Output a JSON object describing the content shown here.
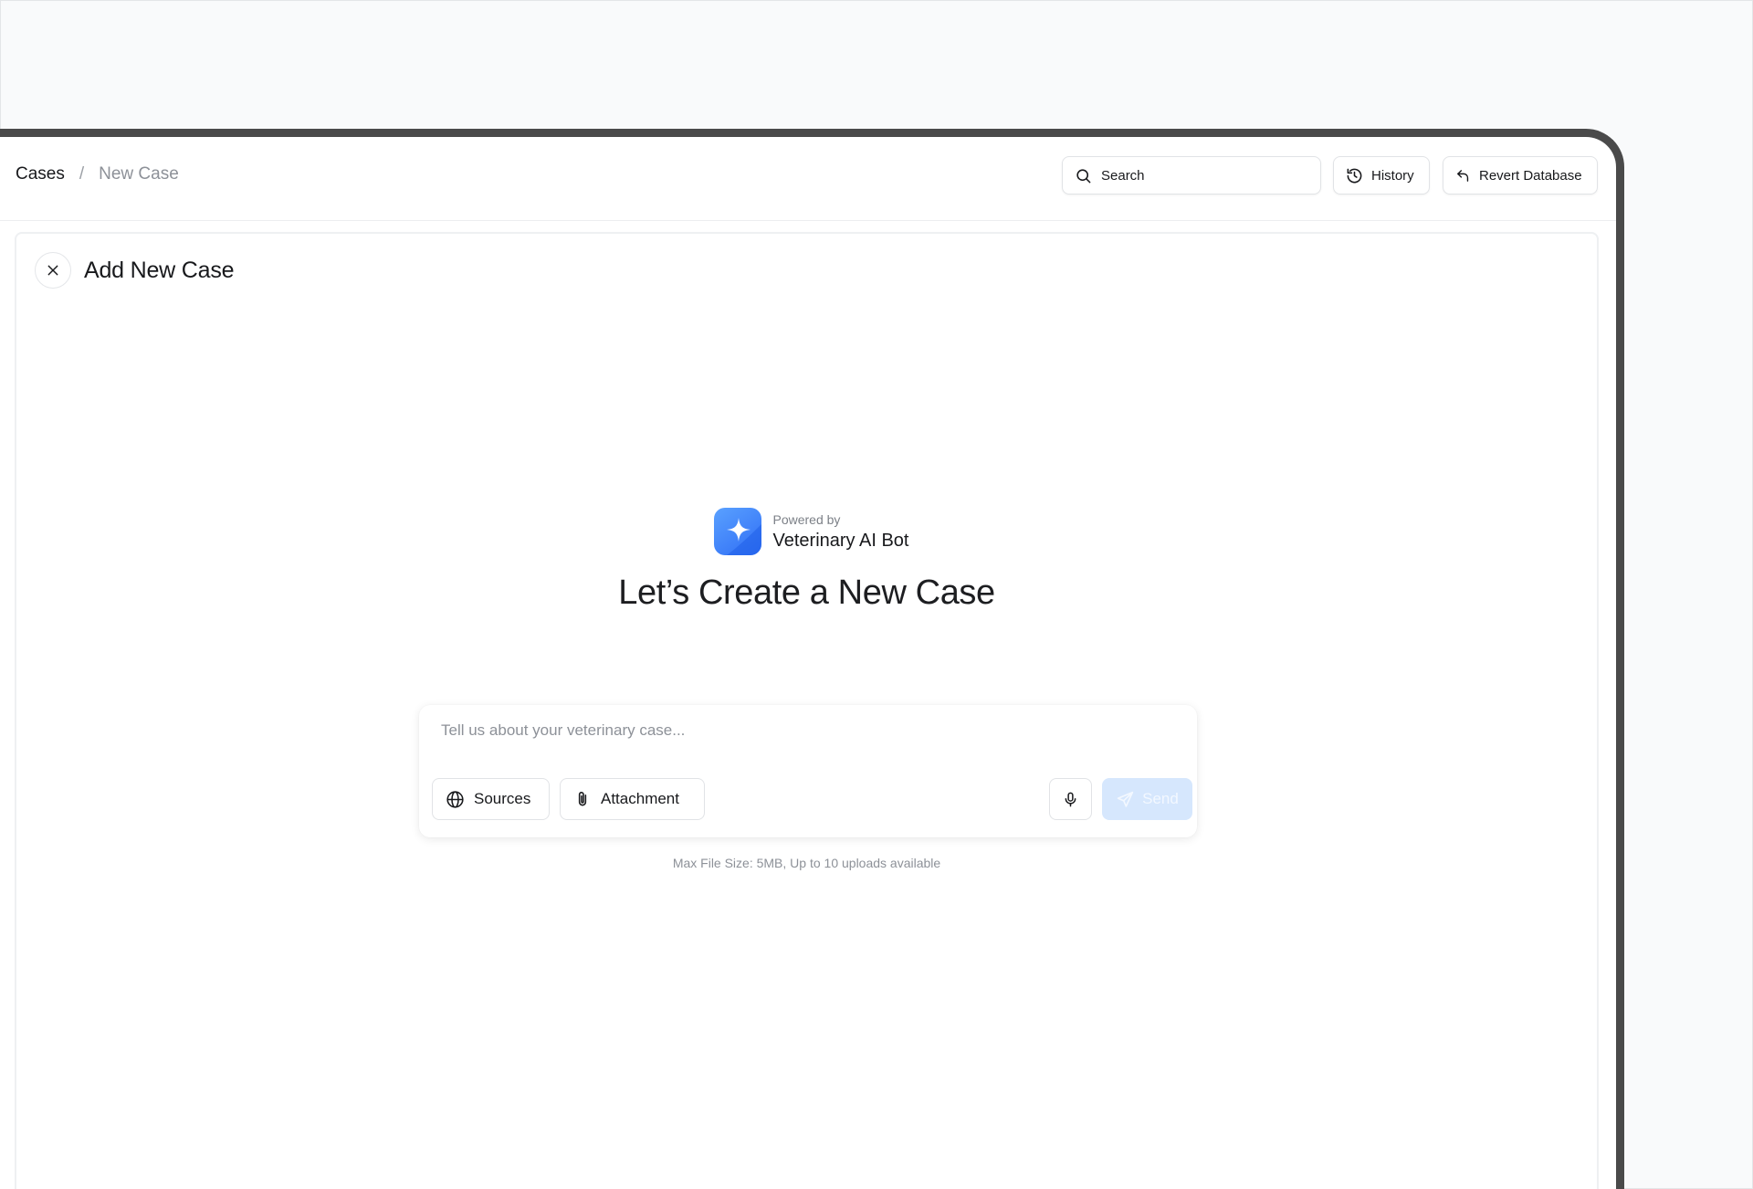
{
  "breadcrumb": {
    "root": "Cases",
    "separator": "/",
    "current": "New Case"
  },
  "header": {
    "search_placeholder": "Search",
    "history_label": "History",
    "revert_label": "Revert Database"
  },
  "panel": {
    "title": "Add New Case"
  },
  "hero": {
    "powered_by": "Powered by",
    "bot_name": "Veterinary AI Bot",
    "title": "Let’s Create a New Case"
  },
  "composer": {
    "placeholder": "Tell us about your veterinary case...",
    "value": "",
    "sources_label": "Sources",
    "attachment_label": "Attachment",
    "send_label": "Send",
    "hint": "Max File Size: 5MB, Up to 10 uploads available"
  },
  "icons": {
    "search": "search-icon",
    "history": "history-icon",
    "revert": "undo-icon",
    "close": "close-icon",
    "logo": "sparkle-logo-icon",
    "sources": "globe-icon",
    "attachment": "paperclip-icon",
    "mic": "microphone-icon",
    "send": "send-icon"
  },
  "colors": {
    "accent": "#3b82f6",
    "send_disabled_bg": "#d6e7fd",
    "muted_text": "#8d9198"
  }
}
